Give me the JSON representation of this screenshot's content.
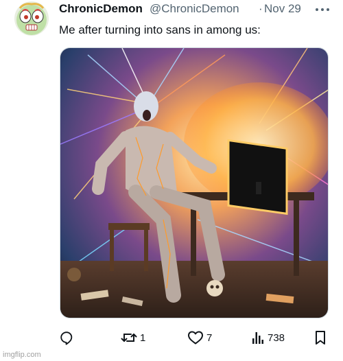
{
  "tweet": {
    "display_name": "ChronicDemon",
    "handle": "@ChronicDemon",
    "separator": "·",
    "timestamp": "Nov 29",
    "text": "Me after turning into sans in among us:",
    "avatar_icon": "cartoon-face-avatar",
    "media_description_icon": "ai-art-image"
  },
  "actions": {
    "reply": {
      "icon": "reply-icon",
      "count": ""
    },
    "retweet": {
      "icon": "retweet-icon",
      "count": "1"
    },
    "like": {
      "icon": "heart-icon",
      "count": "7"
    },
    "views": {
      "icon": "views-icon",
      "count": "738"
    },
    "bookmark": {
      "icon": "bookmark-icon",
      "count": ""
    }
  },
  "colors": {
    "text_primary": "#0f1419",
    "text_secondary": "#536471",
    "border": "#cfd9de"
  },
  "watermark": "imgflip.com"
}
